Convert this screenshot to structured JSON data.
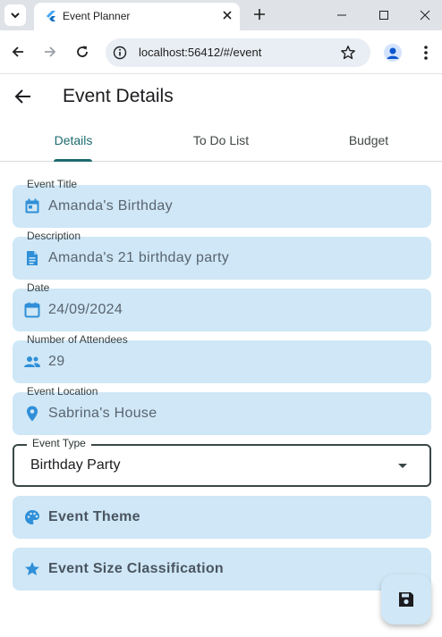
{
  "browser": {
    "tab_title": "Event Planner",
    "url": "localhost:56412/#/event"
  },
  "appbar": {
    "title": "Event Details"
  },
  "tabs": [
    {
      "label": "Details",
      "active": true
    },
    {
      "label": "To Do List",
      "active": false
    },
    {
      "label": "Budget",
      "active": false
    }
  ],
  "form": {
    "event_title": {
      "label": "Event Title",
      "value": "Amanda's Birthday",
      "icon": "calendar-icon"
    },
    "description": {
      "label": "Description",
      "value": "Amanda's 21 birthday party",
      "icon": "document-icon"
    },
    "date": {
      "label": "Date",
      "value": "24/09/2024",
      "icon": "calendar-outline-icon"
    },
    "attendees": {
      "label": "Number of Attendees",
      "value": "29",
      "icon": "people-icon"
    },
    "location": {
      "label": "Event Location",
      "value": "Sabrina's House",
      "icon": "location-pin-icon"
    },
    "event_type": {
      "label": "Event Type",
      "value": "Birthday Party"
    },
    "event_theme": {
      "label": "Event Theme",
      "icon": "palette-icon"
    },
    "event_size": {
      "label": "Event Size Classification",
      "icon": "star-icon"
    }
  },
  "fab": {
    "icon": "save-icon"
  },
  "colors": {
    "accent": "#1d6b6e",
    "field_fill": "#cfe7f6",
    "icon_blue": "#2f8fd8"
  }
}
